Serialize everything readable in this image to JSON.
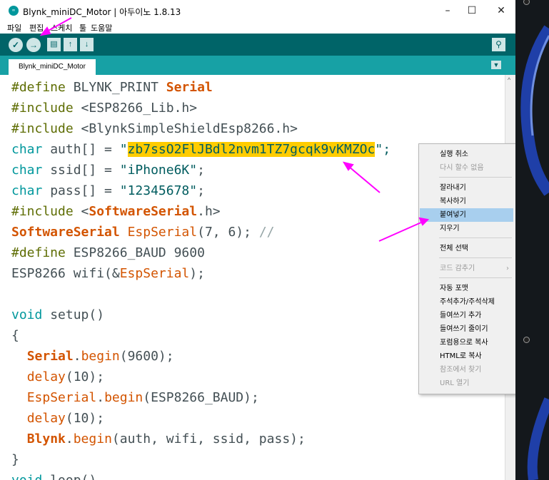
{
  "window": {
    "title": "Blynk_miniDC_Motor | 아두이노 1.8.13",
    "app_icon": "arduino-icon",
    "minimize": "–",
    "maximize": "☐",
    "close": "✕"
  },
  "menu": [
    "파일",
    "편집",
    "스케치",
    "툴",
    "도움말"
  ],
  "toolbar": {
    "verify": "✓",
    "upload": "→",
    "new": "▤",
    "open": "↑",
    "save": "↓",
    "serial_monitor": "⚲"
  },
  "tabs": {
    "active": "Blynk_miniDC_Motor",
    "menu_icon": "▼"
  },
  "code": {
    "l1": {
      "a": "#define ",
      "b": "BLYNK_PRINT ",
      "c": "Serial"
    },
    "l2": {
      "a": "#include ",
      "b": "<ESP8266_Lib.h>"
    },
    "l3": {
      "a": "#include ",
      "b": "<BlynkSimpleShieldEsp8266.h>"
    },
    "l4": {
      "a": "char",
      "b": " auth[] = ",
      "c": "\"",
      "d": "zb7ssO2FlJBdl2nvm1TZ7gcqk9vKMZOc",
      "e": "\";"
    },
    "l5": {
      "a": "char",
      "b": " ssid[] = ",
      "c": "\"iPhone6K\"",
      "d": ";"
    },
    "l6": {
      "a": "char",
      "b": " pass[] = ",
      "c": "\"12345678\"",
      "d": ";"
    },
    "l7": {
      "a": "#include ",
      "b": "<",
      "c": "SoftwareSerial",
      "d": ".h>"
    },
    "l8": {
      "a": "SoftwareSerial",
      "b": " ",
      "c": "EspSerial",
      "d": "(7, 6); ",
      "e": "//"
    },
    "l9": {
      "a": "#define ",
      "b": "ESP8266_BAUD 9600"
    },
    "l10": {
      "a": "ESP8266 wifi(&",
      "b": "EspSerial",
      "c": ");"
    },
    "l12": {
      "a": "void",
      "b": " setup()"
    },
    "l13": {
      "a": "{"
    },
    "l14": {
      "a": "  ",
      "b": "Serial",
      "c": ".",
      "d": "begin",
      "e": "(9600);"
    },
    "l15": {
      "a": "  ",
      "b": "delay",
      "c": "(10);"
    },
    "l16": {
      "a": "  ",
      "b": "EspSerial",
      "c": ".",
      "d": "begin",
      "e": "(ESP8266_BAUD);"
    },
    "l17": {
      "a": "  ",
      "b": "delay",
      "c": "(10);"
    },
    "l18": {
      "a": "  ",
      "b": "Blynk",
      "c": ".",
      "d": "begin",
      "e": "(auth, wifi, ssid, pass);"
    },
    "l19": {
      "a": "}"
    },
    "l20": {
      "a": "void",
      "b": " loop()"
    }
  },
  "context_menu": {
    "items": [
      {
        "label": "실행 취소",
        "disabled": false
      },
      {
        "label": "다시 할수 없음",
        "disabled": true
      },
      {
        "label": "잘라내기",
        "disabled": false
      },
      {
        "label": "복사하기",
        "disabled": false
      },
      {
        "label": "붙여넣기",
        "disabled": false,
        "highlighted": true
      },
      {
        "label": "지우기",
        "disabled": false
      },
      {
        "label": "전체 선택",
        "disabled": false
      },
      {
        "label": "코드 감추기",
        "disabled": true
      },
      {
        "label": "자동 포맷",
        "disabled": false
      },
      {
        "label": "주석추가/주석삭제",
        "disabled": false
      },
      {
        "label": "들여쓰기 추가",
        "disabled": false
      },
      {
        "label": "들여쓰기 줄이기",
        "disabled": false
      },
      {
        "label": "포럼용으로 복사",
        "disabled": false
      },
      {
        "label": "HTML로 복사",
        "disabled": false
      },
      {
        "label": "참조에서 찾기",
        "disabled": true
      },
      {
        "label": "URL 열기",
        "disabled": true
      }
    ],
    "submenu_arrow": "›"
  },
  "colors": {
    "toolbar": "#006468",
    "tabbar": "#17a1a5",
    "selection": "#ffcc00",
    "annotation_arrow": "#ff00ff",
    "menu_highlight": "#a8cfee"
  }
}
